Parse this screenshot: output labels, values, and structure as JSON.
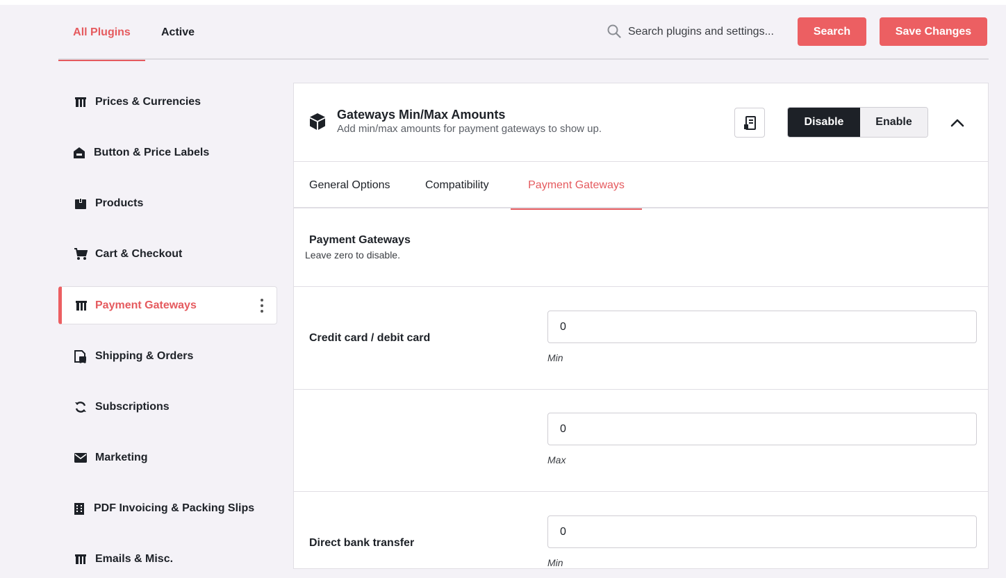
{
  "header": {
    "tabs": [
      {
        "label": "All Plugins",
        "active": true
      },
      {
        "label": "Active",
        "active": false
      }
    ],
    "search": {
      "placeholder": "Search plugins and settings..."
    },
    "search_button": "Search",
    "save_button": "Save Changes"
  },
  "sidebar": {
    "items": [
      {
        "label": "Prices & Currencies",
        "icon": "tag-icon"
      },
      {
        "label": "Button & Price Labels",
        "icon": "label-icon"
      },
      {
        "label": "Products",
        "icon": "box-icon"
      },
      {
        "label": "Cart & Checkout",
        "icon": "cart-icon"
      },
      {
        "label": "Payment Gateways",
        "icon": "gateway-icon",
        "active": true
      },
      {
        "label": "Shipping & Orders",
        "icon": "shipping-icon"
      },
      {
        "label": "Subscriptions",
        "icon": "refresh-icon"
      },
      {
        "label": "Marketing",
        "icon": "mail-icon"
      },
      {
        "label": "PDF Invoicing & Packing Slips",
        "icon": "building-icon"
      },
      {
        "label": "Emails & Misc.",
        "icon": "tag-icon"
      }
    ]
  },
  "module": {
    "title": "Gateways Min/Max Amounts",
    "description": "Add min/max amounts for payment gateways to show up.",
    "disable_label": "Disable",
    "enable_label": "Enable",
    "state": "Disable"
  },
  "subtabs": [
    {
      "label": "General Options"
    },
    {
      "label": "Compatibility"
    },
    {
      "label": "Payment Gateways",
      "active": true
    }
  ],
  "section": {
    "title": "Payment Gateways",
    "description": "Leave zero to disable."
  },
  "rows": [
    {
      "label": "Credit card / debit card",
      "value": "0",
      "hint": "Min"
    },
    {
      "label": "",
      "value": "0",
      "hint": "Max"
    },
    {
      "label": "Direct bank transfer",
      "value": "0",
      "hint": "Min"
    }
  ],
  "colors": {
    "accent": "#ec5f62",
    "dark": "#1d2127",
    "background": "#f4f2f7"
  }
}
